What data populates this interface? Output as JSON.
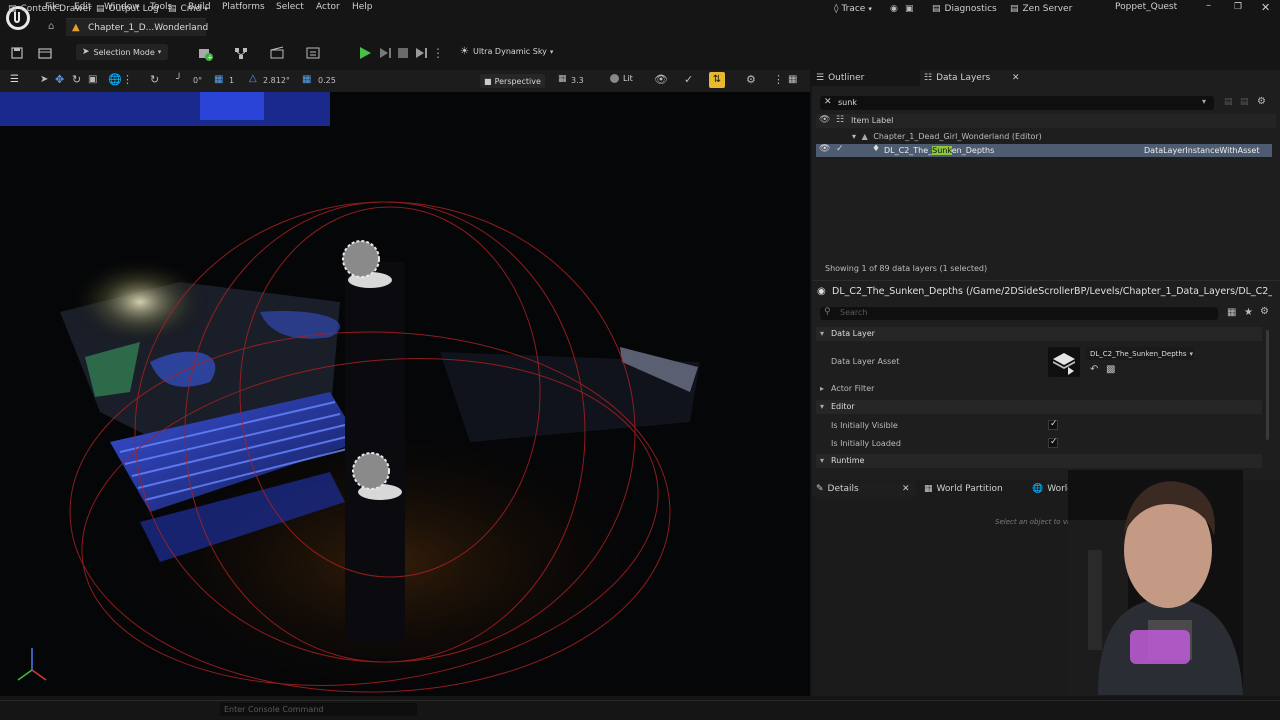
{
  "app": {
    "project_name": "Poppet_Quest",
    "level_tab": "Chapter_1_D...Wonderland"
  },
  "menu": [
    "File",
    "Edit",
    "Window",
    "Tools",
    "Build",
    "Platforms",
    "Select",
    "Actor",
    "Help"
  ],
  "toolbar": {
    "mode": "Selection Mode",
    "sky": "Ultra Dynamic Sky"
  },
  "viewport_bar": {
    "rotate_snap": "0°",
    "grid_snap": "1",
    "scale_snap": "2.812°",
    "cam_speed_val": "0.25",
    "perspective": "Perspective",
    "fov": "3.3",
    "view_mode": "Lit"
  },
  "outliner": {
    "tab_outliner": "Outliner",
    "tab_data_layers": "Data Layers",
    "search_value": "sunk",
    "column_label": "Item Label",
    "tree": [
      {
        "label": "Chapter_1_Dead_Girl_Wonderland (Editor)",
        "type": ""
      },
      {
        "label_pre": "DL_C2_The_",
        "label_hl": "Sunk",
        "label_post": "en_Depths",
        "type": "DataLayerInstanceWithAsset"
      }
    ],
    "status": "Showing 1 of 89 data layers (1 selected)"
  },
  "details_top": {
    "title": "DL_C2_The_Sunken_Depths (/Game/2DSideScrollerBP/Levels/Chapter_1_Data_Layers/DL_C2_Th",
    "search_placeholder": "Search",
    "sections": {
      "data_layer": "Data Layer",
      "actor_filter": "Actor Filter",
      "editor": "Editor",
      "runtime": "Runtime"
    },
    "props": {
      "data_layer_asset_label": "Data Layer Asset",
      "data_layer_asset_value": "DL_C2_The_Sunken_Depths",
      "initially_visible_label": "Is Initially Visible",
      "initially_visible": true,
      "initially_loaded_label": "Is Initially Loaded",
      "initially_loaded": true
    }
  },
  "details_bottom": {
    "tab_details": "Details",
    "tab_world_partition": "World Partition",
    "tab_world_settings": "World Settings",
    "empty_hint": "Select an object to view details."
  },
  "bottombar": {
    "content_drawer": "Content Drawer",
    "output_log": "Output Log",
    "cmd": "Cmd",
    "console_placeholder": "Enter Console Command",
    "trace": "Trace",
    "diagnostics": "Diagnostics",
    "zen_server": "Zen Server"
  },
  "colors": {
    "accent_selected_row": "#4e5c72",
    "search_highlight": "#8cc63f",
    "play_green": "#46c046"
  }
}
